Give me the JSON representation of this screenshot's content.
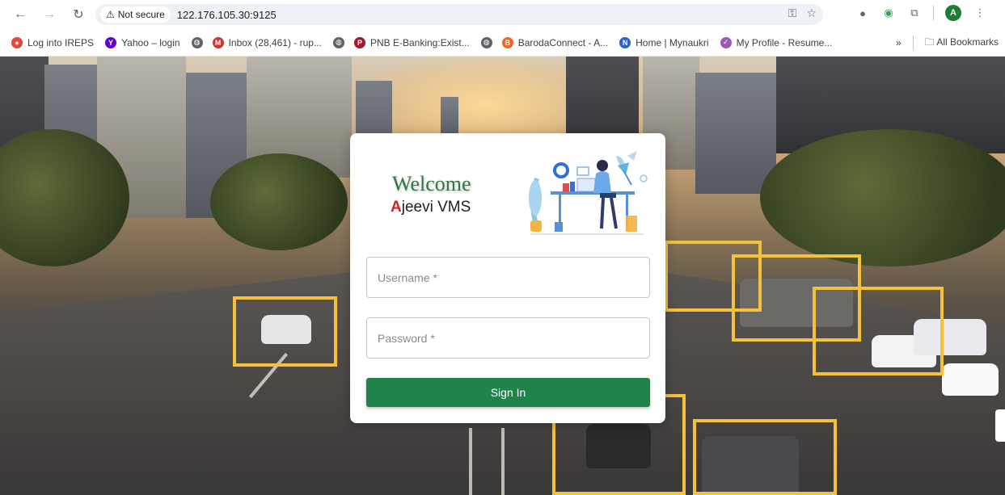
{
  "browser": {
    "security_label": "Not secure",
    "url": "122.176.105.30:9125",
    "profile_initial": "A"
  },
  "bookmarks": {
    "items": [
      {
        "label": "Log into IREPS",
        "icon": "ireps-icon",
        "color": "#e8453c"
      },
      {
        "label": "Yahoo – login",
        "icon": "yahoo-icon",
        "color": "#6001d2"
      },
      {
        "label": "",
        "icon": "globe-icon",
        "color": "#5f6368"
      },
      {
        "label": "Inbox (28,461) - rup...",
        "icon": "gmail-icon",
        "color": "#d93025"
      },
      {
        "label": "",
        "icon": "globe-icon",
        "color": "#5f6368"
      },
      {
        "label": "PNB E-Banking:Exist...",
        "icon": "pnb-icon",
        "color": "#a5162a"
      },
      {
        "label": "",
        "icon": "globe-icon",
        "color": "#5f6368"
      },
      {
        "label": "BarodaConnect - A...",
        "icon": "baroda-icon",
        "color": "#f26522"
      },
      {
        "label": "Home | Mynaukri",
        "icon": "naukri-icon",
        "color": "#2d63c8"
      },
      {
        "label": "My Profile - Resume...",
        "icon": "resume-icon",
        "color": "#9b59b6"
      }
    ],
    "overflow": "»",
    "all_bookmarks": "All Bookmarks"
  },
  "login": {
    "welcome": "Welcome",
    "brand_first": "A",
    "brand_rest": "jeevi VMS",
    "username_placeholder": "Username *",
    "password_placeholder": "Password *",
    "signin_label": "Sign In"
  },
  "colors": {
    "primary": "#1e8449",
    "brand_red": "#d32027",
    "detection_box": "#f6c13a"
  }
}
